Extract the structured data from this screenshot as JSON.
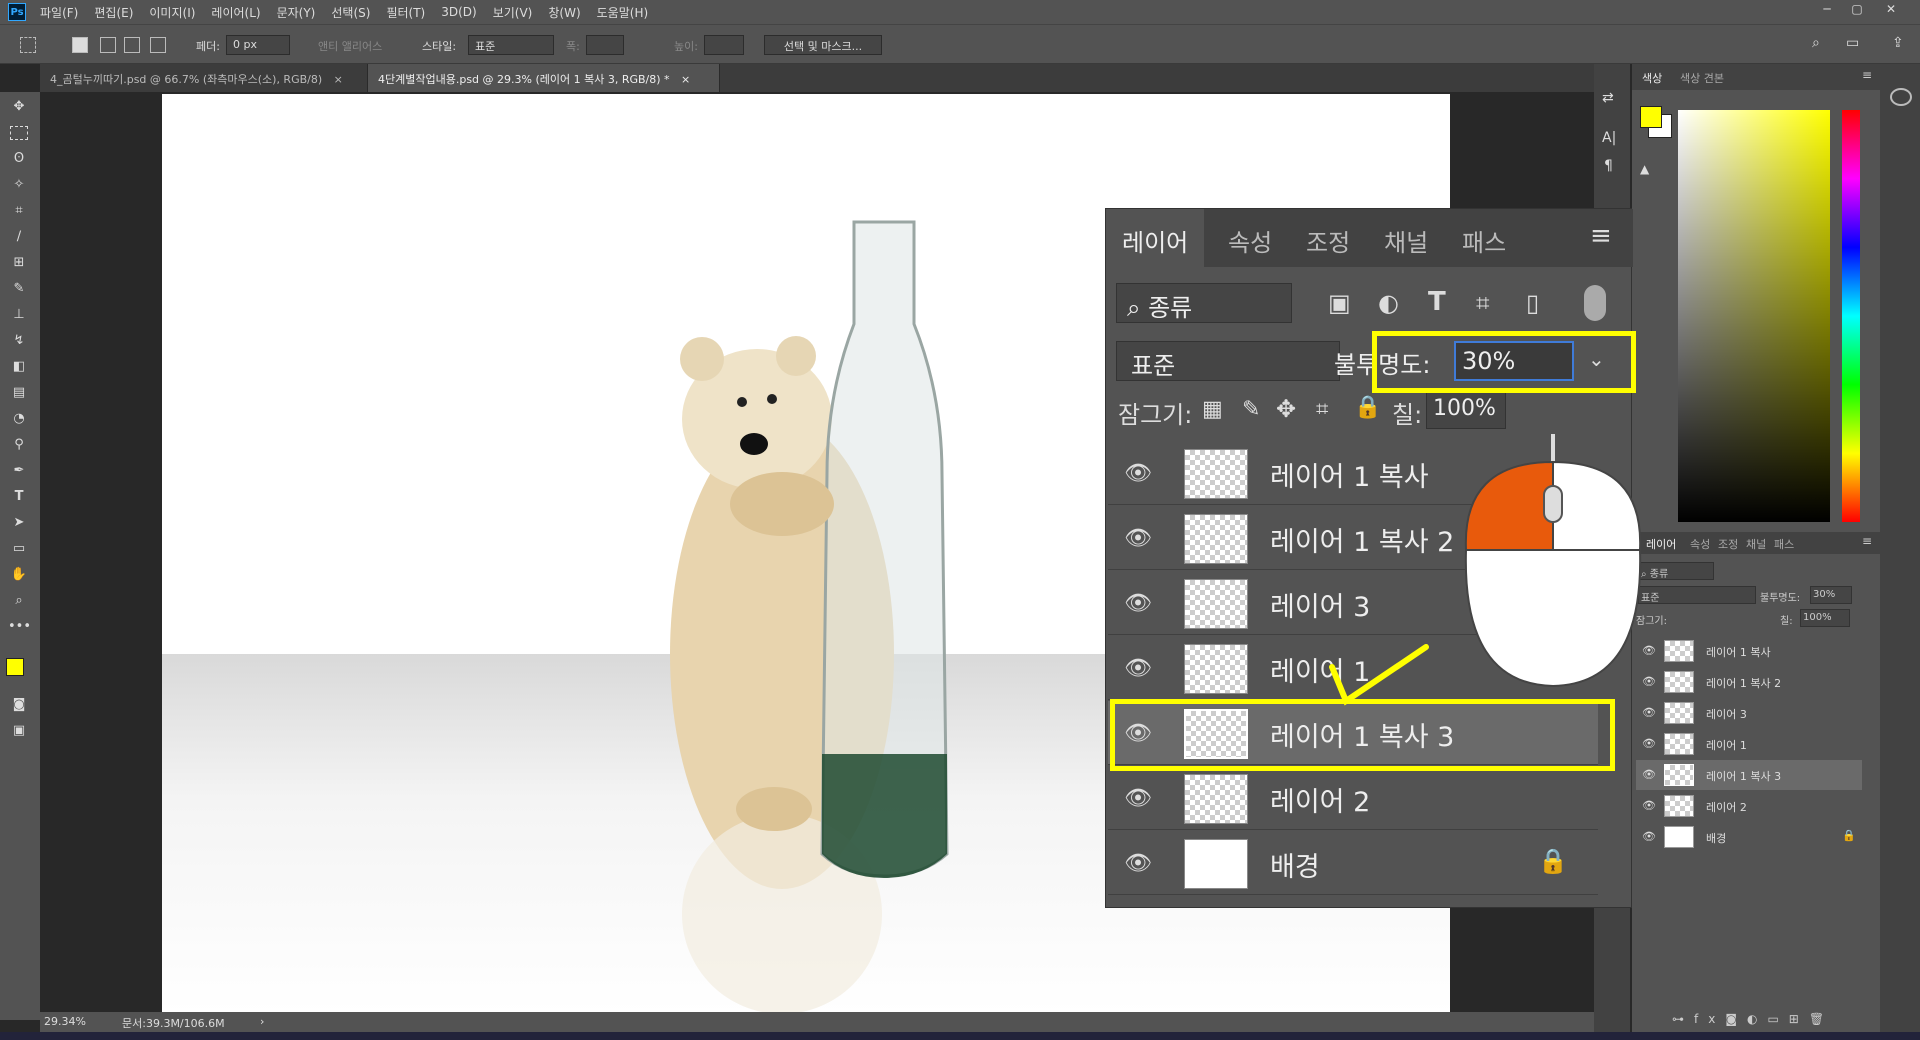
{
  "menubar": {
    "logo": "Ps",
    "items": [
      "파일(F)",
      "편집(E)",
      "이미지(I)",
      "레이어(L)",
      "문자(Y)",
      "선택(S)",
      "필터(T)",
      "3D(D)",
      "보기(V)",
      "창(W)",
      "도움말(H)"
    ],
    "min": "─",
    "max": "▢",
    "close": "✕"
  },
  "options": {
    "feather_label": "페더:",
    "feather_value": "0 px",
    "antialias": "앤티 앨리어스",
    "style_label": "스타일:",
    "style_value": "표준",
    "width_label": "폭:",
    "height_label": "높이:",
    "select_mask": "선택 및 마스크..."
  },
  "tabs": [
    {
      "label": "4_곰털누끼따기.psd @ 66.7% (좌측마우스(소), RGB/8)",
      "close": "×"
    },
    {
      "label": "4단계별작업내용.psd @ 29.3% (레이어 1 복사 3, RGB/8) *",
      "close": "×"
    }
  ],
  "status": {
    "zoom": "29.34%",
    "doc": "문서:39.3M/106.6M",
    "arrow": "›"
  },
  "colorpanel": {
    "tab_color": "색상",
    "tab_swatches": "색상 견본",
    "fg": "#ffff00",
    "bg": "#ffffff"
  },
  "bigpanel": {
    "tabs": [
      "레이어",
      "속성",
      "조정",
      "채널",
      "패스"
    ],
    "filter": "⌕ 종류",
    "blend": "표준",
    "opacity_label": "불투명도:",
    "opacity_value": "30%",
    "lock_label": "잠그기:",
    "fill_label": "칠:",
    "fill_value": "100%",
    "layers": [
      {
        "name": "레이어 1 복사"
      },
      {
        "name": "레이어 1 복사 2"
      },
      {
        "name": "레이어 3"
      },
      {
        "name": "레이어 1"
      },
      {
        "name": "레이어 1 복사 3"
      },
      {
        "name": "레이어 2"
      },
      {
        "name": "배경"
      }
    ]
  },
  "smallpanel": {
    "tabs": [
      "레이어",
      "속성",
      "조정",
      "채널",
      "패스"
    ],
    "filter": "⌕ 종류",
    "blend": "표준",
    "opacity_label": "불투명도:",
    "opacity_value": "30%",
    "lock_label": "잠그기:",
    "fill_label": "칠:",
    "fill_value": "100%",
    "layers": [
      {
        "name": "레이어 1 복사"
      },
      {
        "name": "레이어 1 복사 2"
      },
      {
        "name": "레이어 3"
      },
      {
        "name": "레이어 1"
      },
      {
        "name": "레이어 1 복사 3"
      },
      {
        "name": "레이어 2"
      },
      {
        "name": "배경"
      }
    ]
  },
  "colors": {
    "highlight": "#ffff00",
    "mouse_left": "#e85a0c",
    "selected_row": "#6a6a6a"
  }
}
